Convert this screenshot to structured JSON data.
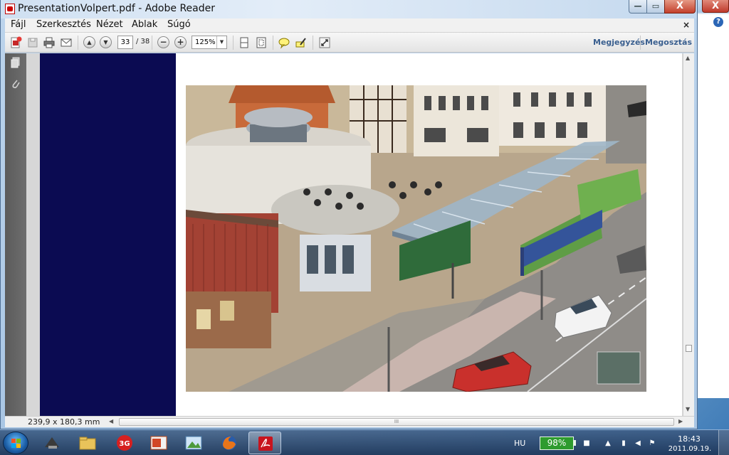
{
  "window": {
    "title": "PresentationVolpert.pdf - Adobe Reader",
    "controls": {
      "minimize": "—",
      "maximize": "▭",
      "close": "X"
    }
  },
  "background_window": {
    "close": "X",
    "help": "?"
  },
  "menubar": {
    "items": [
      "Fájl",
      "Szerkesztés",
      "Nézet",
      "Ablak",
      "Súgó"
    ],
    "doc_close": "×"
  },
  "toolbar": {
    "page_current": "33",
    "page_total": "/ 38",
    "zoom": "125%",
    "comment_link": "Megjegyzés",
    "share_link": "Megosztás",
    "zoom_out": "−",
    "zoom_in": "+",
    "prev_page": "▲",
    "next_page": "▼"
  },
  "statusbar": {
    "page_size": "239,9 x 180,3 mm",
    "grip": "III"
  },
  "taskbar": {
    "language": "HU",
    "battery": "98%",
    "time": "18:43",
    "date": "2011.09.19.",
    "pinned": [
      "network-app",
      "file-explorer",
      "3g-modem",
      "powerpoint",
      "photo-viewer",
      "firefox",
      "adobe-reader"
    ]
  },
  "colors": {
    "page_navy": "#0b0b52",
    "battery_green": "#2e9b2e",
    "link_blue": "#3a5f8f"
  }
}
